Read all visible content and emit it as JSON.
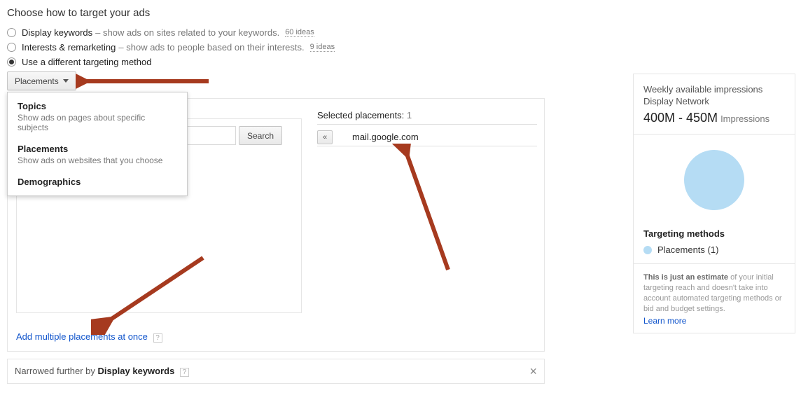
{
  "header": "Choose how to target your ads",
  "options": {
    "keywords": {
      "label": "Display keywords",
      "desc": "– show ads on sites related to your keywords.",
      "badge": "60 ideas"
    },
    "interests": {
      "label": "Interests & remarketing",
      "desc": "– show ads to people based on their interests.",
      "badge": "9 ideas"
    },
    "different": {
      "label": "Use a different targeting method"
    }
  },
  "dropdown": {
    "selected": "Placements"
  },
  "menu": {
    "topics": {
      "title": "Topics",
      "desc": "Show ads on pages about specific subjects"
    },
    "placements": {
      "title": "Placements",
      "desc": "Show ads on websites that you choose"
    },
    "demographics": {
      "title": "Demographics"
    }
  },
  "search": {
    "placeholder": "",
    "button": "Search"
  },
  "addLink": "Add multiple placements at once",
  "selected": {
    "header": "Selected placements:",
    "count": "1",
    "item": "mail.google.com",
    "removeGlyph": "«"
  },
  "narrow": {
    "prefix": "Narrowed further by ",
    "strong": "Display keywords"
  },
  "sidebar": {
    "title": "Weekly available impressions",
    "network": "Display Network",
    "range": "400M - 450M",
    "unit": "Impressions",
    "tmTitle": "Targeting methods",
    "tmItem": "Placements (1)",
    "disclaimerBold": "This is just an estimate",
    "disclaimerRest": " of your initial targeting reach and doesn't take into account automated targeting methods or bid and budget settings.",
    "learn": "Learn more"
  }
}
